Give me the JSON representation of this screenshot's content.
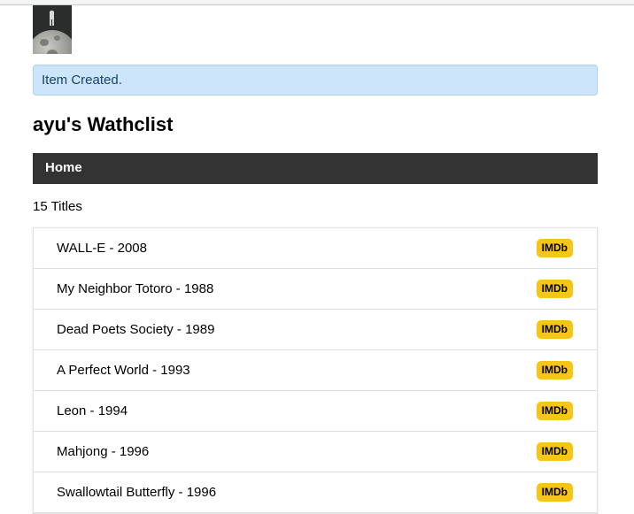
{
  "flash": {
    "message": "Item Created."
  },
  "page": {
    "title": "ayu's Wathclist"
  },
  "nav": {
    "home_label": "Home"
  },
  "summary": {
    "count_text": "15 Titles"
  },
  "badge_label": "IMDb",
  "items": [
    {
      "title": "WALL-E - 2008"
    },
    {
      "title": "My Neighbor Totoro - 1988"
    },
    {
      "title": "Dead Poets Society - 1989"
    },
    {
      "title": "A Perfect World - 1993"
    },
    {
      "title": "Leon - 1994"
    },
    {
      "title": "Mahjong - 1996"
    },
    {
      "title": "Swallowtail Butterfly - 1996"
    }
  ],
  "colors": {
    "navbar": "#333333",
    "flash_bg": "#cce5fb",
    "imdb_badge": "#f5c518"
  },
  "icons": {
    "avatar": "moon-astronaut-avatar"
  }
}
